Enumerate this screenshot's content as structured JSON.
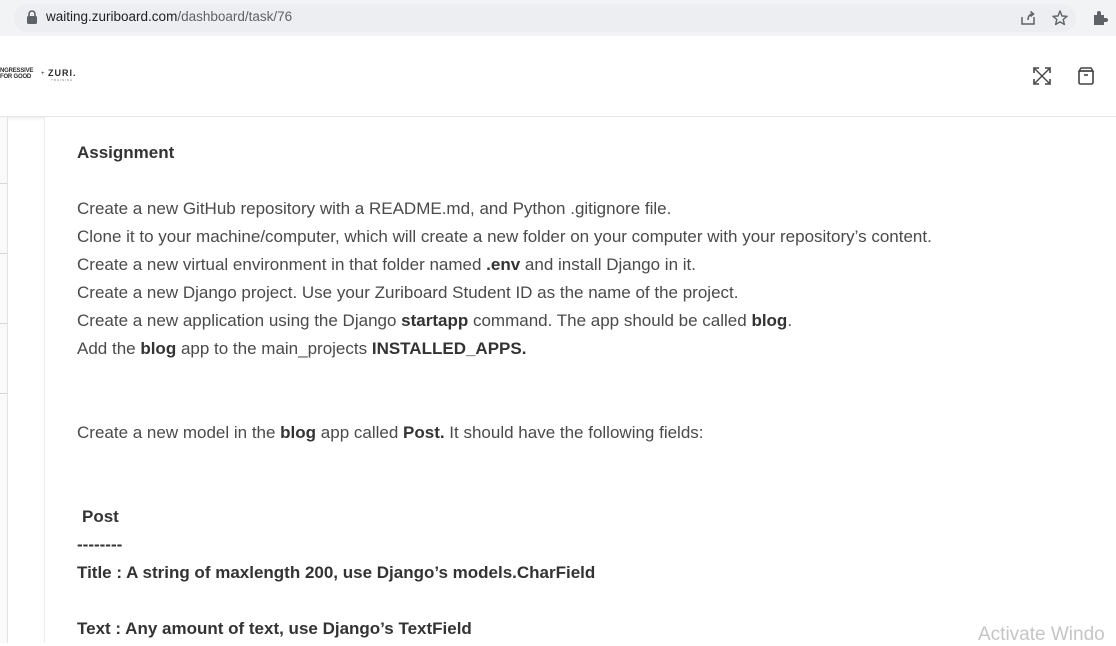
{
  "browser": {
    "url_host": "waiting.zuriboard.com",
    "url_path": "/dashboard/task/76"
  },
  "header": {
    "logo_text_a": "NGRESSIVE\nFOR GOOD",
    "logo_plus": "+",
    "logo_text_b": "ZURI.",
    "logo_text_c": "TRAINING"
  },
  "task": {
    "heading": "Assignment",
    "steps": [
      [
        "Create a new GitHub repository with a README.md, and Python .gitignore file."
      ],
      [
        "Clone it to your machine/computer, which will create a new folder on your computer with your repository’s content."
      ],
      [
        "Create a new virtual environment in that folder named ",
        ".env",
        " and install Django in it."
      ],
      [
        "Create a new Django project. Use your Zuriboard Student ID as the name of the project."
      ],
      [
        "Create a new application using the Django ",
        "startapp",
        " command. The app should be called ",
        "blog",
        "."
      ],
      [
        "Add the ",
        "blog",
        " app to the main_projects ",
        "INSTALLED_APPS."
      ]
    ],
    "model_intro": [
      "Create a new model in the ",
      "blog",
      " app called ",
      "Post.",
      " It should have the following fields:"
    ],
    "model_name": "Post",
    "separator": "--------",
    "field_title": "Title : A string of maxlength 200, use Django’s models.CharField",
    "field_text": "Text : Any amount of text, use Django’s TextField"
  },
  "watermark": "Activate Windo"
}
